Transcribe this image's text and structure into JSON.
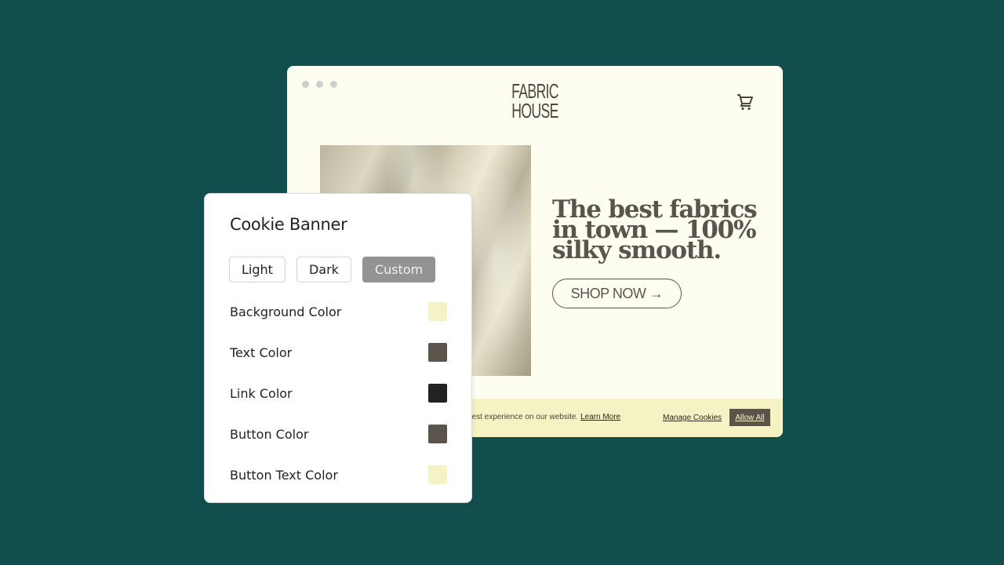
{
  "site": {
    "logo_line1": "FABRIC",
    "logo_line2": "HOUSE",
    "headline": "The best fabrics in town  — 100% silky smooth.",
    "shop_button": "SHOP NOW →",
    "cart_icon": "shopping-cart-icon",
    "cookie_bar": {
      "text": "best experience on our website.",
      "learn_more": "Learn More",
      "manage_cookies": "Manage Cookies",
      "allow_all": "Allow All"
    }
  },
  "panel": {
    "title": "Cookie Banner",
    "modes": [
      {
        "label": "Light",
        "active": false
      },
      {
        "label": "Dark",
        "active": false
      },
      {
        "label": "Custom",
        "active": true
      }
    ],
    "colors": [
      {
        "label": "Background Color",
        "value": "#f5f3c4"
      },
      {
        "label": "Text Color",
        "value": "#5b544a"
      },
      {
        "label": "Link Color",
        "value": "#222222"
      },
      {
        "label": "Button Color",
        "value": "#5b544a"
      },
      {
        "label": "Button Text Color",
        "value": "#f5f3c4"
      }
    ]
  }
}
